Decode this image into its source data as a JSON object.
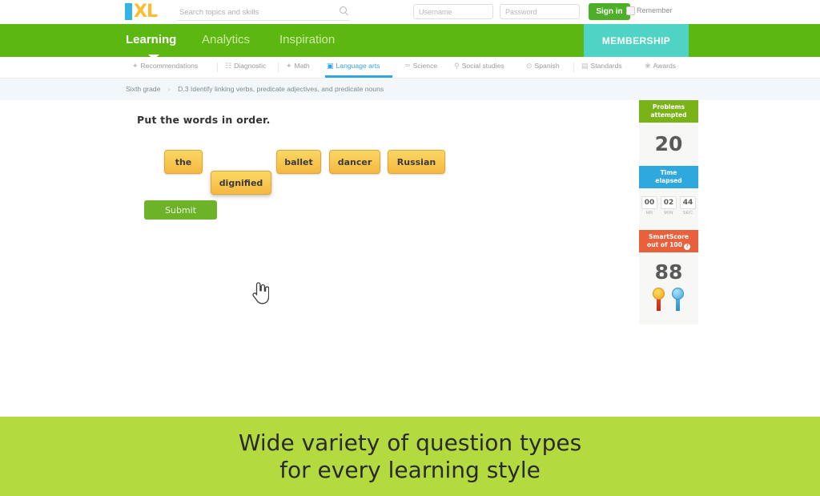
{
  "header": {
    "logo_alt": "IXL",
    "logo_i": "I",
    "logo_xl": "XL",
    "search_placeholder": "Search topics and skills",
    "search_value": "",
    "username_placeholder": "Username",
    "username_value": "",
    "password_placeholder": "Password",
    "password_value": "",
    "signin_label": "Sign in",
    "remember_label": "Remember"
  },
  "mainnav": {
    "items": [
      {
        "label": "Learning",
        "active": true
      },
      {
        "label": "Analytics",
        "active": false
      },
      {
        "label": "Inspiration",
        "active": false
      }
    ],
    "membership_label": "MEMBERSHIP"
  },
  "subnav": {
    "items": [
      {
        "label": "Recommendations",
        "icon": "sparkle-icon",
        "glyph": "✦",
        "active": false
      },
      {
        "label": "Diagnostic",
        "icon": "chart-icon",
        "glyph": "☷",
        "active": false
      },
      {
        "label": "Math",
        "icon": "math-icon",
        "glyph": "✦",
        "active": false
      },
      {
        "label": "Language arts",
        "icon": "book-icon",
        "glyph": "▣",
        "active": true
      },
      {
        "label": "Science",
        "icon": "flask-icon",
        "glyph": "⚰",
        "active": false
      },
      {
        "label": "Social studies",
        "icon": "globe-icon",
        "glyph": "⚲",
        "active": false
      },
      {
        "label": "Spanish",
        "icon": "speech-icon",
        "glyph": "⊙",
        "active": false
      },
      {
        "label": "Standards",
        "icon": "list-icon",
        "glyph": "▤",
        "active": false
      },
      {
        "label": "Awards",
        "icon": "trophy-icon",
        "glyph": "❀",
        "active": false
      }
    ]
  },
  "breadcrumb": {
    "grade": "Sixth grade",
    "separator": "›",
    "skill": "D.3 Identify linking verbs, predicate adjectives, and predicate nouns"
  },
  "question": {
    "prompt": "Put the words in order.",
    "tiles": [
      {
        "id": "the",
        "label": "the"
      },
      {
        "id": "dignified",
        "label": "dignified",
        "dragging": true
      },
      {
        "id": "ballet",
        "label": "ballet"
      },
      {
        "id": "dancer",
        "label": "dancer"
      },
      {
        "id": "russian",
        "label": "Russian"
      }
    ],
    "submit_label": "Submit",
    "cursor": "pointing-hand-cursor"
  },
  "scorepanel": {
    "problems_label_line1": "Problems",
    "problems_label_line2": "attempted",
    "problems_value": "20",
    "time_label_line1": "Time",
    "time_label_line2": "elapsed",
    "time": {
      "hr_value": "00",
      "hr_label": "HR",
      "min_value": "02",
      "min_label": "MIN",
      "sec_value": "44",
      "sec_label": "SEC"
    },
    "smartscore_label_line1": "SmartScore",
    "smartscore_label_line2": "out of 100",
    "smartscore_info": "?",
    "smartscore_value": "88",
    "ribbons": [
      "gold-ribbon-icon",
      "blue-ribbon-icon"
    ]
  },
  "caption": {
    "line1": "Wide variety of question types",
    "line2": "for every learning style"
  },
  "colors": {
    "brand_green": "#5cb811",
    "membership_teal": "#4fd3c5",
    "signin_green": "#4caf27",
    "link_blue": "#35a3dc",
    "tile_yellow": "#f5b841",
    "caption_green": "#b3db3f",
    "smartscore_orange": "#e8603c",
    "time_blue": "#2fa8e0",
    "problems_green": "#7ab317"
  }
}
